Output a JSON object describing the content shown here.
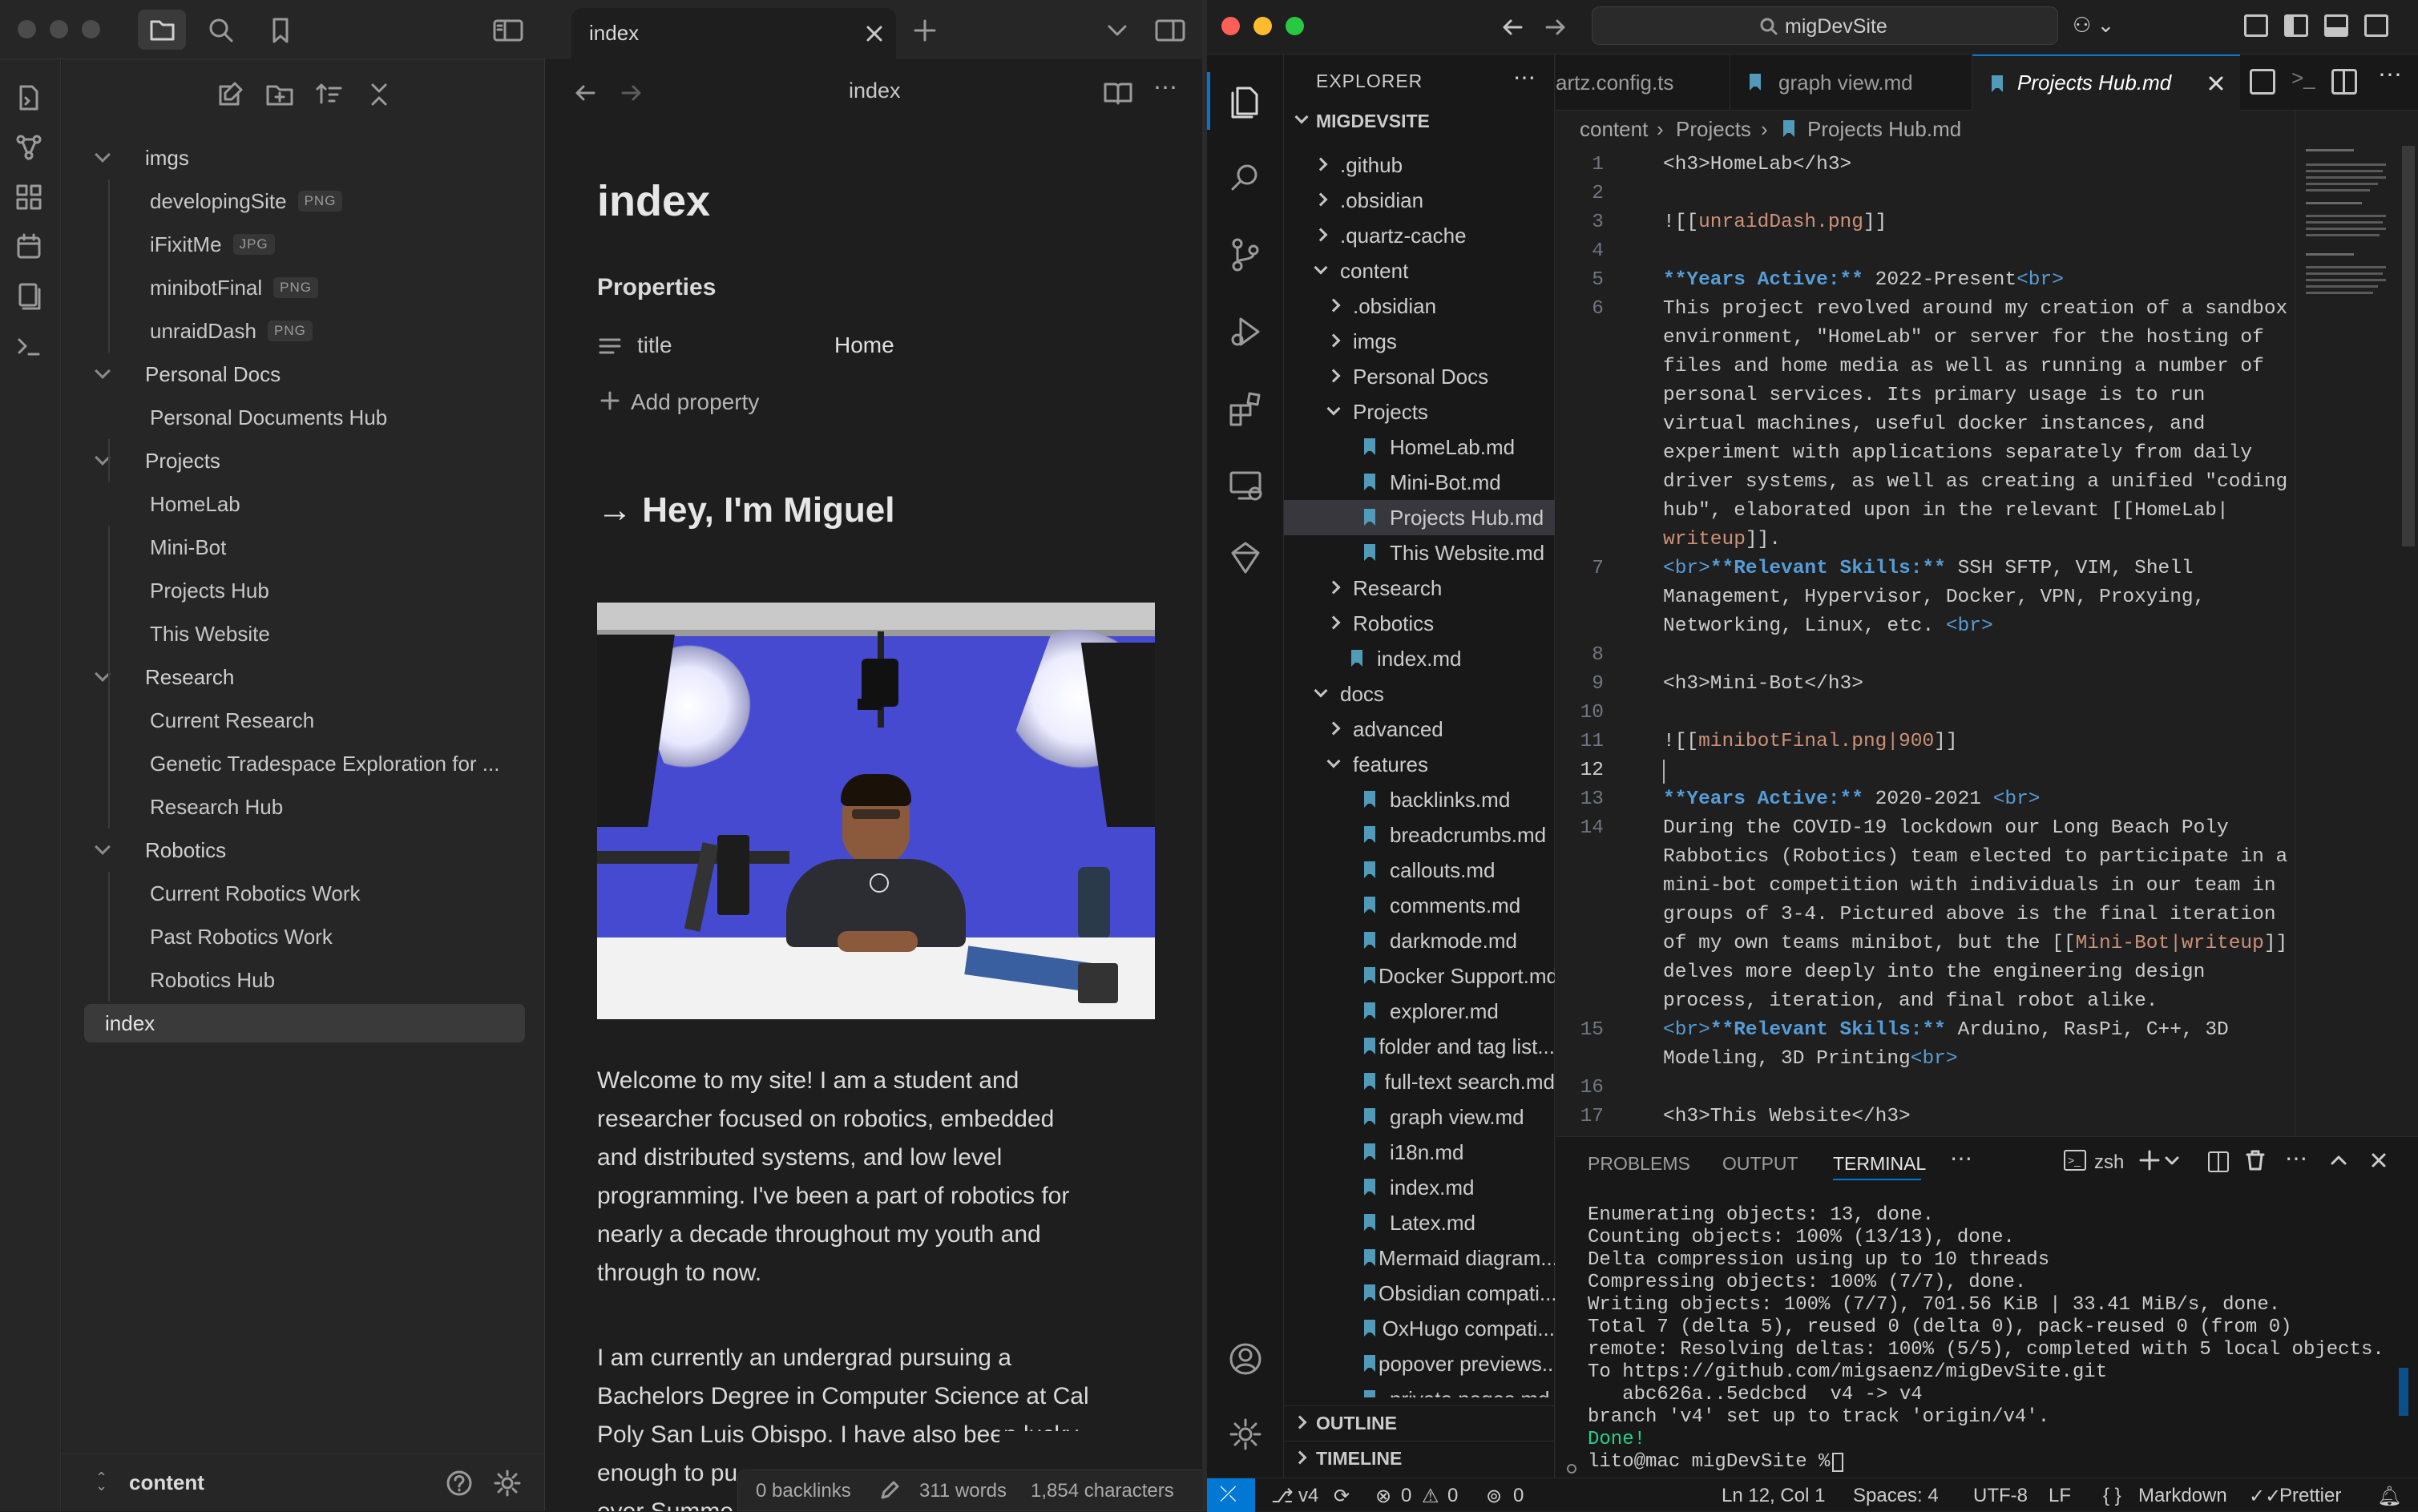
{
  "obsidian": {
    "tab_title": "index",
    "header_title": "index",
    "tree": [
      {
        "label": "imgs",
        "type": "folder"
      },
      {
        "label": "developingSite",
        "type": "file",
        "badge": "PNG"
      },
      {
        "label": "iFixitMe",
        "type": "file",
        "badge": "JPG"
      },
      {
        "label": "minibotFinal",
        "type": "file",
        "badge": "PNG"
      },
      {
        "label": "unraidDash",
        "type": "file",
        "badge": "PNG"
      },
      {
        "label": "Personal Docs",
        "type": "folder"
      },
      {
        "label": "Personal Documents Hub",
        "type": "file"
      },
      {
        "label": "Projects",
        "type": "folder"
      },
      {
        "label": "HomeLab",
        "type": "file"
      },
      {
        "label": "Mini-Bot",
        "type": "file"
      },
      {
        "label": "Projects Hub",
        "type": "file"
      },
      {
        "label": "This Website",
        "type": "file"
      },
      {
        "label": "Research",
        "type": "folder"
      },
      {
        "label": "Current Research",
        "type": "file"
      },
      {
        "label": "Genetic Tradespace Exploration for ...",
        "type": "file"
      },
      {
        "label": "Research Hub",
        "type": "file"
      },
      {
        "label": "Robotics",
        "type": "folder"
      },
      {
        "label": "Current Robotics Work",
        "type": "file"
      },
      {
        "label": "Past Robotics Work",
        "type": "file"
      },
      {
        "label": "Robotics Hub",
        "type": "file"
      },
      {
        "label": "index",
        "type": "root"
      }
    ],
    "vault_name": "content",
    "doc": {
      "title": "index",
      "properties_heading": "Properties",
      "property_key": "title",
      "property_value": "Home",
      "add_property": "Add property",
      "heading": "→ Hey, I'm Miguel",
      "para1": [
        "Welcome to my site! I am a student and",
        "researcher focused on robotics, embedded",
        "and distributed systems, and low level",
        "programming. I've been a part of robotics for",
        "nearly a decade throughout my youth and",
        "through to now."
      ],
      "para2": [
        "I am currently an undergrad pursuing a",
        "Bachelors Degree in Computer Science at Cal",
        "Poly San Luis Obispo. I have also been lucky",
        "enough to pu",
        "ever Summe"
      ]
    },
    "status": {
      "backlinks": "0 backlinks",
      "words": "311 words",
      "chars": "1,854 characters"
    }
  },
  "vscode": {
    "search": "migDevSite",
    "explorer_title": "EXPLORER",
    "root": "MIGDEVSITE",
    "tree": [
      {
        "label": ".github",
        "depth": 0,
        "type": "folder-closed"
      },
      {
        "label": ".obsidian",
        "depth": 0,
        "type": "folder-closed"
      },
      {
        "label": ".quartz-cache",
        "depth": 0,
        "type": "folder-closed"
      },
      {
        "label": "content",
        "depth": 0,
        "type": "folder-open"
      },
      {
        "label": ".obsidian",
        "depth": 1,
        "type": "folder-closed"
      },
      {
        "label": "imgs",
        "depth": 1,
        "type": "folder-closed"
      },
      {
        "label": "Personal Docs",
        "depth": 1,
        "type": "folder-closed"
      },
      {
        "label": "Projects",
        "depth": 1,
        "type": "folder-open"
      },
      {
        "label": "HomeLab.md",
        "depth": 2,
        "type": "md"
      },
      {
        "label": "Mini-Bot.md",
        "depth": 2,
        "type": "md"
      },
      {
        "label": "Projects Hub.md",
        "depth": 2,
        "type": "md"
      },
      {
        "label": "This Website.md",
        "depth": 2,
        "type": "md"
      },
      {
        "label": "Research",
        "depth": 1,
        "type": "folder-closed"
      },
      {
        "label": "Robotics",
        "depth": 1,
        "type": "folder-closed"
      },
      {
        "label": "index.md",
        "depth": 1,
        "type": "md"
      },
      {
        "label": "docs",
        "depth": 0,
        "type": "folder-open"
      },
      {
        "label": "advanced",
        "depth": 1,
        "type": "folder-closed"
      },
      {
        "label": "features",
        "depth": 1,
        "type": "folder-open"
      },
      {
        "label": "backlinks.md",
        "depth": 2,
        "type": "md"
      },
      {
        "label": "breadcrumbs.md",
        "depth": 2,
        "type": "md"
      },
      {
        "label": "callouts.md",
        "depth": 2,
        "type": "md"
      },
      {
        "label": "comments.md",
        "depth": 2,
        "type": "md"
      },
      {
        "label": "darkmode.md",
        "depth": 2,
        "type": "md"
      },
      {
        "label": "Docker Support.md",
        "depth": 2,
        "type": "md"
      },
      {
        "label": "explorer.md",
        "depth": 2,
        "type": "md"
      },
      {
        "label": "folder and tag list...",
        "depth": 2,
        "type": "md"
      },
      {
        "label": "full-text search.md",
        "depth": 2,
        "type": "md"
      },
      {
        "label": "graph view.md",
        "depth": 2,
        "type": "md"
      },
      {
        "label": "i18n.md",
        "depth": 2,
        "type": "md"
      },
      {
        "label": "index.md",
        "depth": 2,
        "type": "md"
      },
      {
        "label": "Latex.md",
        "depth": 2,
        "type": "md"
      },
      {
        "label": "Mermaid diagram...",
        "depth": 2,
        "type": "md"
      },
      {
        "label": "Obsidian compati...",
        "depth": 2,
        "type": "md"
      },
      {
        "label": "OxHugo compati...",
        "depth": 2,
        "type": "md"
      },
      {
        "label": "popover previews...",
        "depth": 2,
        "type": "md"
      },
      {
        "label": "private pages.md",
        "depth": 2,
        "type": "md"
      }
    ],
    "outline": "OUTLINE",
    "timeline": "TIMELINE",
    "tabs": [
      {
        "label": "artz.config.ts"
      },
      {
        "label": "graph view.md"
      },
      {
        "label": "Projects Hub.md"
      }
    ],
    "breadcrumb": [
      "content",
      "Projects",
      "Projects Hub.md"
    ],
    "panel_tabs": [
      "PROBLEMS",
      "OUTPUT",
      "TERMINAL"
    ],
    "shell": "zsh",
    "terminal": [
      "Enumerating objects: 13, done.",
      "Counting objects: 100% (13/13), done.",
      "Delta compression using up to 10 threads",
      "Compressing objects: 100% (7/7), done.",
      "Writing objects: 100% (7/7), 701.56 KiB | 33.41 MiB/s, done.",
      "Total 7 (delta 5), reused 0 (delta 0), pack-reused 0 (from 0)",
      "remote: Resolving deltas: 100% (5/5), completed with 5 local objects.",
      "To https://github.com/migsaenz/migDevSite.git",
      "   abc626a..5edcbcd  v4 -> v4",
      "branch 'v4' set up to track 'origin/v4'.",
      "Done!",
      "lito@mac migDevSite % "
    ],
    "status": {
      "branch": "v4",
      "problems": "0",
      "warnings": "0",
      "ports": "0",
      "pos": "Ln 12, Col 1",
      "spaces": "Spaces: 4",
      "enc": "UTF-8",
      "eol": "LF",
      "lang": "Markdown",
      "fmt": "Prettier"
    }
  },
  "code_lines": [
    {
      "n": "1",
      "t": "<h3>HomeLab</h3>"
    },
    {
      "n": "2",
      "t": ""
    },
    {
      "n": "3",
      "t": "![[unraidDash.png]]"
    },
    {
      "n": "4",
      "t": ""
    },
    {
      "n": "5",
      "t": "**Years Active:** 2022-Present<br>"
    },
    {
      "n": "6",
      "t": "This project revolved around my creation of a sandbox"
    },
    {
      "n": "",
      "t": "environment, \"HomeLab\" or server for the hosting of"
    },
    {
      "n": "",
      "t": "files and home media as well as running a number of"
    },
    {
      "n": "",
      "t": "personal services. Its primary usage is to run"
    },
    {
      "n": "",
      "t": "virtual machines, useful docker instances, and"
    },
    {
      "n": "",
      "t": "experiment with applications separately from daily"
    },
    {
      "n": "",
      "t": "driver systems, as well as creating a unified \"coding"
    },
    {
      "n": "",
      "t": "hub\", elaborated upon in the relevant [[HomeLab|"
    },
    {
      "n": "",
      "t": "writeup]]."
    },
    {
      "n": "7",
      "t": "<br>**Relevant Skills:** SSH SFTP, VIM, Shell"
    },
    {
      "n": "",
      "t": "Management, Hypervisor, Docker, VPN, Proxying,"
    },
    {
      "n": "",
      "t": "Networking, Linux, etc. <br>"
    },
    {
      "n": "8",
      "t": ""
    },
    {
      "n": "9",
      "t": "<h3>Mini-Bot</h3>"
    },
    {
      "n": "10",
      "t": ""
    },
    {
      "n": "11",
      "t": "![[minibotFinal.png|900]]"
    },
    {
      "n": "12",
      "t": ""
    },
    {
      "n": "13",
      "t": "**Years Active:** 2020-2021 <br>"
    },
    {
      "n": "14",
      "t": "During the COVID-19 lockdown our Long Beach Poly"
    },
    {
      "n": "",
      "t": "Rabbotics (Robotics) team elected to participate in a"
    },
    {
      "n": "",
      "t": "mini-bot competition with individuals in our team in"
    },
    {
      "n": "",
      "t": "groups of 3-4. Pictured above is the final iteration"
    },
    {
      "n": "",
      "t": "of my own teams minibot, but the [[Mini-Bot|writeup]]"
    },
    {
      "n": "",
      "t": "delves more deeply into the engineering design"
    },
    {
      "n": "",
      "t": "process, iteration, and final robot alike."
    },
    {
      "n": "15",
      "t": "<br>**Relevant Skills:** Arduino, RasPi, C++, 3D"
    },
    {
      "n": "",
      "t": "Modeling, 3D Printing<br>"
    },
    {
      "n": "16",
      "t": ""
    },
    {
      "n": "17",
      "t": "<h3>This Website</h3>"
    }
  ]
}
